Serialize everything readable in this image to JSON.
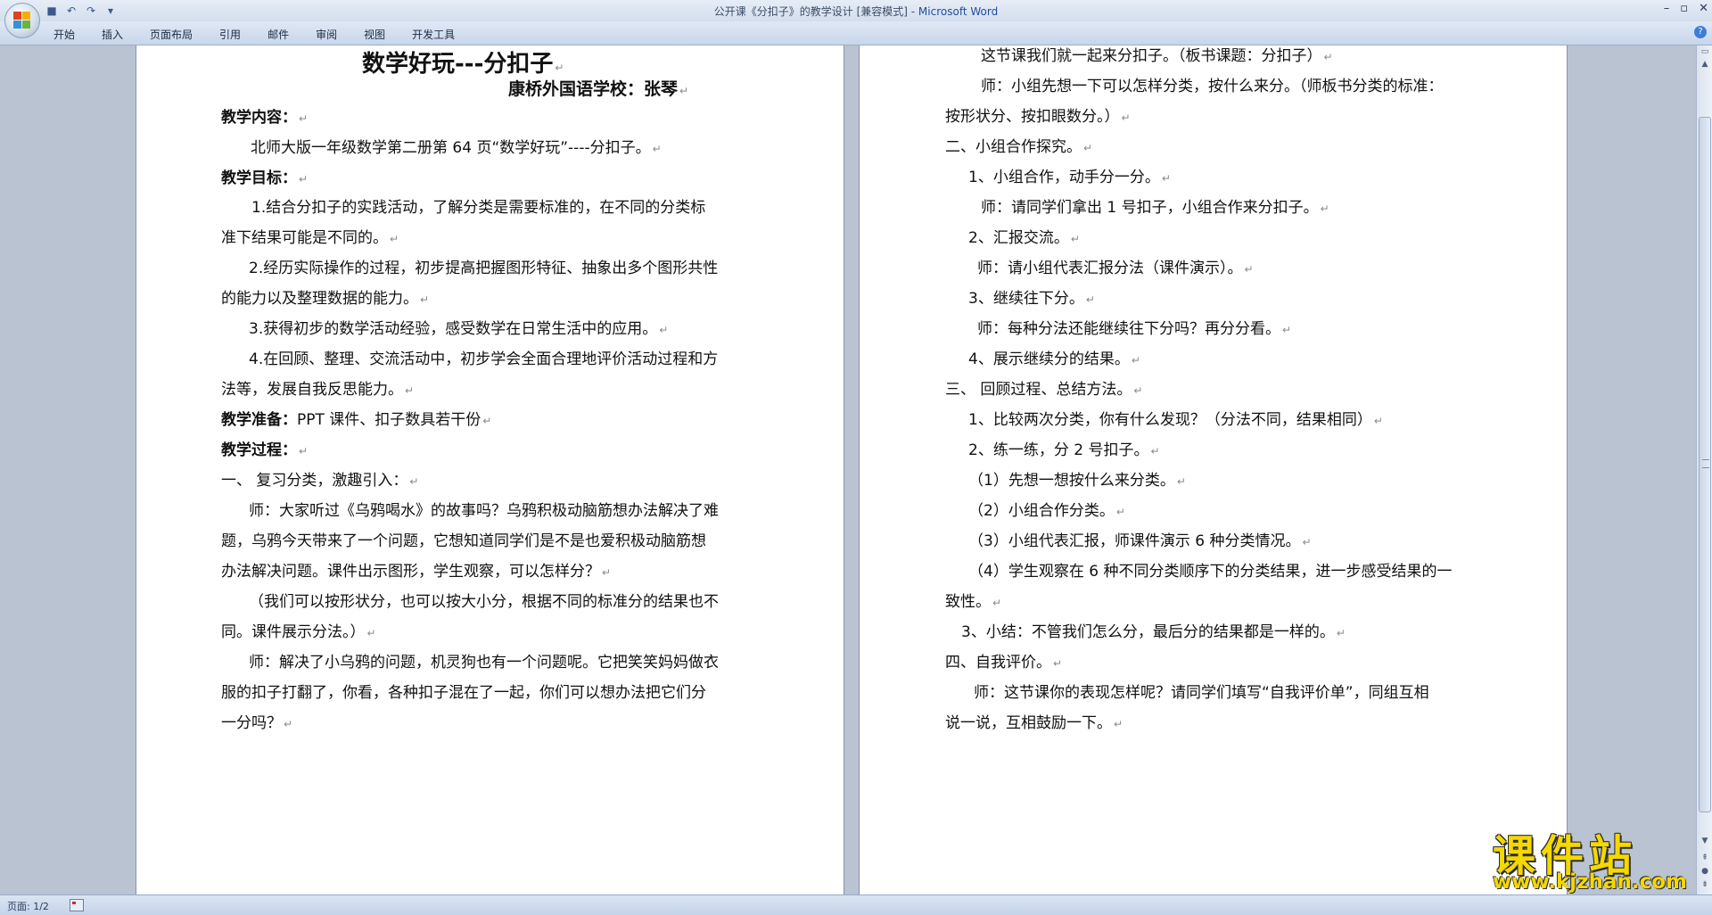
{
  "window": {
    "title_doc": "公开课《分扣子》的教学设计 [兼容模式] - ",
    "title_app": "Microsoft Word"
  },
  "menu": {
    "tabs": [
      "开始",
      "插入",
      "页面布局",
      "引用",
      "邮件",
      "审阅",
      "视图",
      "开发工具"
    ]
  },
  "left_page": {
    "lines": [
      "数学好玩---分扣子",
      "康桥外国语学校：张琴",
      "教学内容：",
      "北师大版一年级数学第二册第 64 页“数学好玩”----分扣子。",
      "教学目标：",
      "1.结合分扣子的实践活动，了解分类是需要标准的，在不同的分类标",
      "准下结果可能是不同的。",
      "2.经历实际操作的过程，初步提高把握图形特征、抽象出多个图形共性",
      "的能力以及整理数据的能力。",
      "3.获得初步的数学活动经验，感受数学在日常生活中的应用。",
      "4.在回顾、整理、交流活动中，初步学会全面合理地评价活动过程和方",
      "法等，发展自我反思能力。",
      "教学准备：",
      "PPT 课件、扣子数具若干份",
      "教学过程：",
      "一、  复习分类，激趣引入：",
      "师：大家听过《乌鸦喝水》的故事吗？乌鸦积极动脑筋想办法解决了难",
      "题，乌鸦今天带来了一个问题，它想知道同学们是不是也爱积极动脑筋想",
      "办法解决问题。课件出示图形，学生观察，可以怎样分？",
      "（我们可以按形状分，也可以按大小分，根据不同的标准分的结果也不",
      "同。课件展示分法。）",
      "师：解决了小乌鸦的问题，机灵狗也有一个问题呢。它把笑笑妈妈做衣",
      "服的扣子打翻了，你看，各种扣子混在了一起，你们可以想办法把它们分",
      "一分吗？"
    ]
  },
  "right_page": {
    "lines": [
      "这节课我们就一起来分扣子。（板书课题：分扣子）",
      "师：小组先想一下可以怎样分类，按什么来分。（师板书分类的标准：",
      "按形状分、按扣眼数分。）",
      "二、小组合作探究。",
      "1、小组合作，动手分一分。",
      "师：请同学们拿出 1 号扣子，小组合作来分扣子。",
      "2、汇报交流。",
      "师：请小组代表汇报分法（课件演示）。",
      "3、继续往下分。",
      "师：每种分法还能继续往下分吗？再分分看。",
      "4、展示继续分的结果。",
      "三、  回顾过程、总结方法。",
      "1、比较两次分类，你有什么发现？（分法不同，结果相同）",
      "2、练一练，分 2 号扣子。",
      "（1）先想一想按什么来分类。",
      "（2）小组合作分类。",
      "（3）小组代表汇报，师课件演示 6 种分类情况。",
      "（4）学生观察在 6 种不同分类顺序下的分类结果，进一步感受结果的一",
      "致性。",
      "3、小结：不管我们怎么分，最后分的结果都是一样的。",
      "四、自我评价。",
      "师：这节课你的表现怎样呢？请同学们填写“自我评价单”，同组互相",
      "说一说，互相鼓励一下。"
    ]
  },
  "paragraph_mark": "↵",
  "status": {
    "page": "页面: 1/2"
  },
  "watermark": {
    "main": "课件站",
    "url": "www.kjzhan.com"
  },
  "icons": {
    "office": "office-button-icon",
    "save": "save-icon",
    "undo": "undo-icon",
    "redo": "redo-icon",
    "help": "help-icon"
  }
}
